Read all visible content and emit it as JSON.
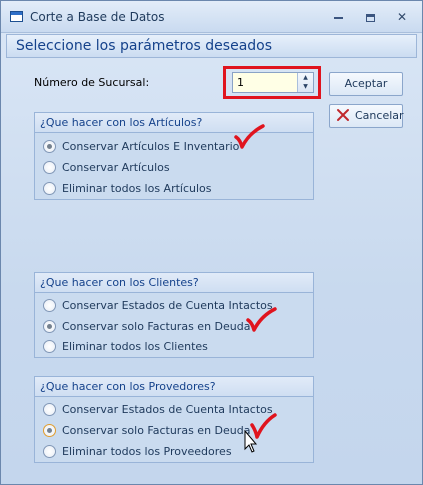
{
  "window": {
    "title": "Corte a Base de Datos",
    "controls": {
      "minimize": "minimize-icon",
      "maximize": "maximize-icon",
      "close": "✕"
    }
  },
  "header": {
    "title": "Seleccione los parámetros deseados"
  },
  "sucursal": {
    "label": "Número de Sucursal:",
    "value": "1",
    "highlight_color": "#e0141e"
  },
  "buttons": {
    "aceptar": "Aceptar",
    "cancelar": "Cancelar"
  },
  "groups": {
    "articulos": {
      "title": "¿Que hacer con los Artículos?",
      "options": [
        "Conservar Artículos E Inventario",
        "Conservar Artículos",
        "Eliminar todos los Artículos"
      ],
      "selected": 0
    },
    "clientes": {
      "title": "¿Que hacer con los Clientes?",
      "options": [
        "Conservar Estados de Cuenta Intactos",
        "Conservar solo Facturas en Deuda",
        "Eliminar todos los Clientes"
      ],
      "selected": 1
    },
    "proveedores": {
      "title": "¿Que hacer con los Provedores?",
      "options": [
        "Conservar Estados de Cuenta Intactos",
        "Conservar solo Facturas en Deuda",
        "Eliminar todos los Proveedores"
      ],
      "selected": 1
    }
  },
  "annotation_color": "#e0141e"
}
